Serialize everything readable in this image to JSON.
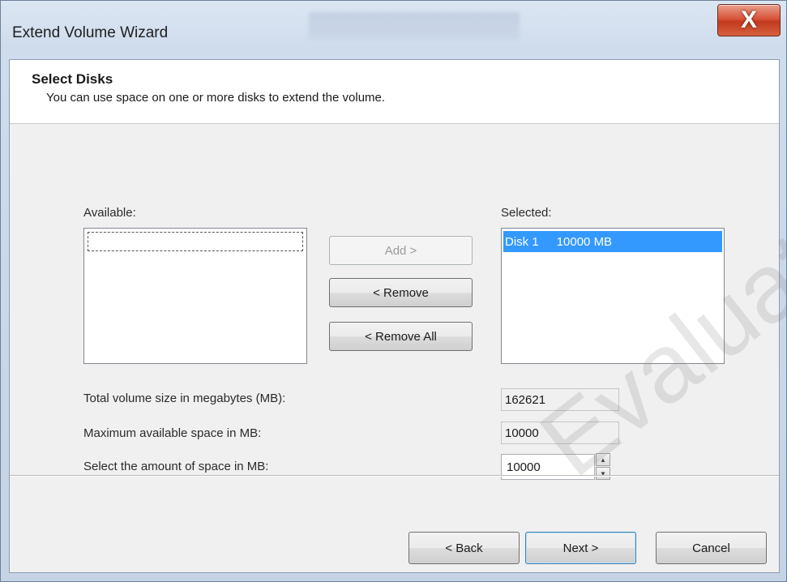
{
  "window": {
    "title": "Extend Volume Wizard",
    "close_glyph": "X"
  },
  "header": {
    "title": "Select Disks",
    "subtitle": "You can use space on one or more disks to extend the volume."
  },
  "available": {
    "label": "Available:",
    "items": []
  },
  "selected": {
    "label": "Selected:",
    "items": [
      {
        "disk": "Disk 1",
        "size": "10000 MB"
      }
    ]
  },
  "buttons": {
    "add": "Add >",
    "remove": "< Remove",
    "remove_all": "< Remove All",
    "back": "< Back",
    "next": "Next >",
    "cancel": "Cancel"
  },
  "fields": {
    "total_label": "Total volume size in megabytes (MB):",
    "total_value": "162621",
    "max_label": "Maximum available space in MB:",
    "max_value": "10000",
    "amount_label": "Select the amount of space in MB:",
    "amount_value": "10000"
  },
  "watermark": "Evaluati",
  "icons": {
    "close": "close-icon",
    "spin_up": "spin-up-icon",
    "spin_down": "spin-down-icon"
  }
}
